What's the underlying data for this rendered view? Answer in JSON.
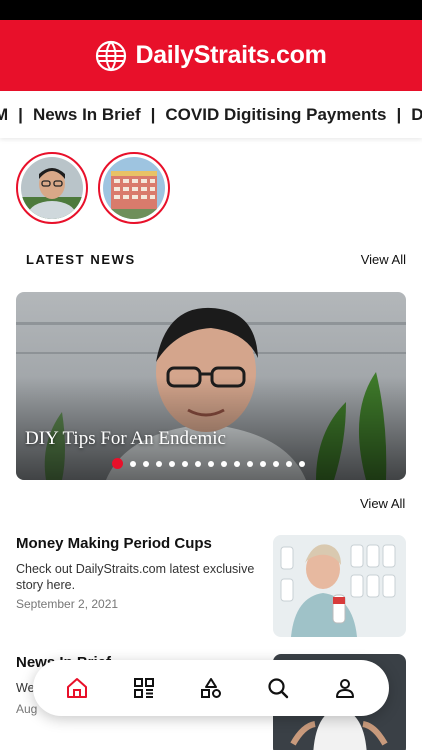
{
  "brand": {
    "name": "DailyStraits.com",
    "color": "#e8102a"
  },
  "ticker": {
    "items": [
      "M",
      "News In Brief",
      "COVID Digitising Payments",
      "Duo's N"
    ],
    "separator": "|"
  },
  "stories": [
    {
      "icon": "person-portrait"
    },
    {
      "icon": "building-photo"
    }
  ],
  "latest": {
    "title": "LATEST NEWS",
    "view_all": "View All"
  },
  "hero": {
    "title": "DIY Tips For An Endemic",
    "slide_count": 15,
    "active_slide": 0
  },
  "list": {
    "view_all": "View All",
    "articles": [
      {
        "title": "Money Making Period Cups",
        "excerpt": "Check out DailyStraits.com latest exclusive story here.",
        "date": "September 2, 2021"
      },
      {
        "title": "News In Brief",
        "excerpt": "We",
        "date": "Aug"
      }
    ]
  },
  "nav": {
    "items": [
      {
        "icon": "home-icon",
        "active": true
      },
      {
        "icon": "grid-icon",
        "active": false
      },
      {
        "icon": "shapes-icon",
        "active": false
      },
      {
        "icon": "search-icon",
        "active": false
      },
      {
        "icon": "profile-icon",
        "active": false
      }
    ]
  }
}
